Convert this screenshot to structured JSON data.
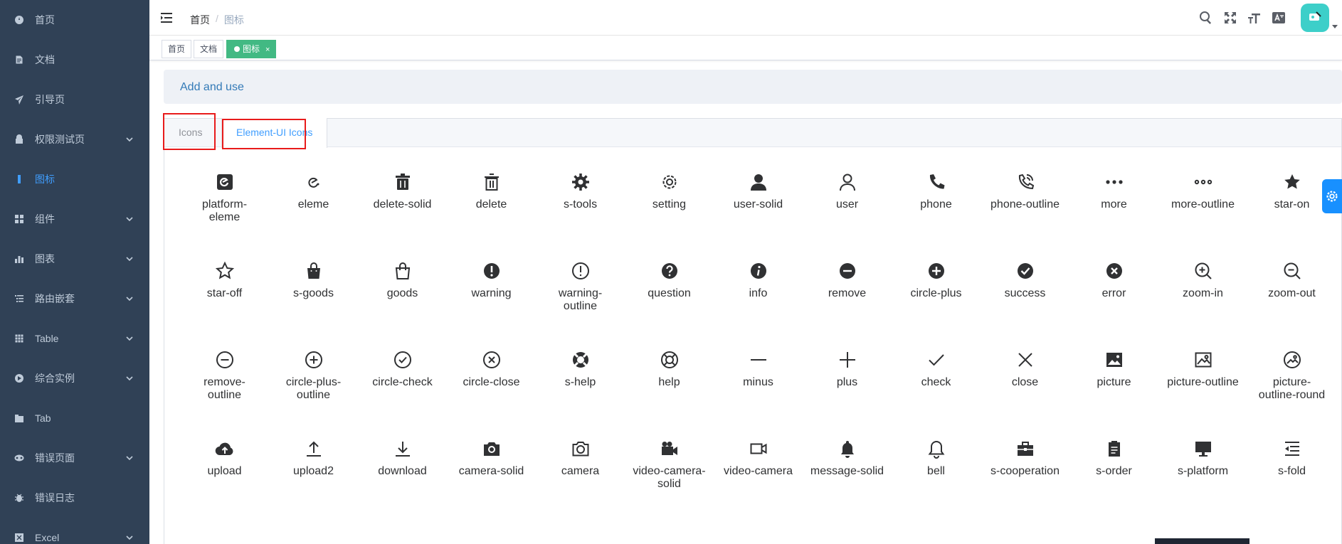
{
  "sidebar": {
    "items": [
      {
        "label": "首页",
        "icon": "dashboard-icon",
        "arrow": false,
        "active": false
      },
      {
        "label": "文档",
        "icon": "document-icon",
        "arrow": false,
        "active": false
      },
      {
        "label": "引导页",
        "icon": "guide-icon",
        "arrow": false,
        "active": false
      },
      {
        "label": "权限测试页",
        "icon": "lock-icon",
        "arrow": true,
        "active": false
      },
      {
        "label": "图标",
        "icon": "icon-icon",
        "arrow": false,
        "active": true
      },
      {
        "label": "组件",
        "icon": "component-icon",
        "arrow": true,
        "active": false
      },
      {
        "label": "图表",
        "icon": "chart-icon",
        "arrow": true,
        "active": false
      },
      {
        "label": "路由嵌套",
        "icon": "nested-icon",
        "arrow": true,
        "active": false
      },
      {
        "label": "Table",
        "icon": "table-icon",
        "arrow": true,
        "active": false
      },
      {
        "label": "综合实例",
        "icon": "example-icon",
        "arrow": true,
        "active": false
      },
      {
        "label": "Tab",
        "icon": "tab-icon",
        "arrow": false,
        "active": false
      },
      {
        "label": "错误页面",
        "icon": "404-icon",
        "arrow": true,
        "active": false
      },
      {
        "label": "错误日志",
        "icon": "bug-icon",
        "arrow": false,
        "active": false
      },
      {
        "label": "Excel",
        "icon": "excel-icon",
        "arrow": true,
        "active": false
      }
    ]
  },
  "navbar": {
    "breadcrumb_home": "首页",
    "breadcrumb_sep": "/",
    "breadcrumb_current": "图标"
  },
  "tags": [
    {
      "label": "首页",
      "active": false
    },
    {
      "label": "文档",
      "active": false
    },
    {
      "label": "图标",
      "active": true,
      "close": "×"
    }
  ],
  "main": {
    "add_use_link": "Add and use",
    "tabs": [
      {
        "label": "Icons",
        "active": false
      },
      {
        "label": "Element-UI Icons",
        "active": true
      }
    ],
    "icons": [
      "platform-eleme",
      "eleme",
      "delete-solid",
      "delete",
      "s-tools",
      "setting",
      "user-solid",
      "user",
      "phone",
      "phone-outline",
      "more",
      "more-outline",
      "star-on",
      "star-off",
      "s-goods",
      "goods",
      "warning",
      "warning-outline",
      "question",
      "info",
      "remove",
      "circle-plus",
      "success",
      "error",
      "zoom-in",
      "zoom-out",
      "remove-outline",
      "circle-plus-outline",
      "circle-check",
      "circle-close",
      "s-help",
      "help",
      "minus",
      "plus",
      "check",
      "close",
      "picture",
      "picture-outline",
      "picture-outline-round",
      "upload",
      "upload2",
      "download",
      "camera-solid",
      "camera",
      "video-camera-solid",
      "video-camera",
      "message-solid",
      "bell",
      "s-cooperation",
      "s-order",
      "s-platform",
      "s-fold"
    ]
  },
  "colors": {
    "sidebar_bg": "#304156",
    "sidebar_text": "#bfcbd9",
    "active": "#409eff",
    "tag_active": "#42b983",
    "highlight_box": "#e81b1b"
  }
}
